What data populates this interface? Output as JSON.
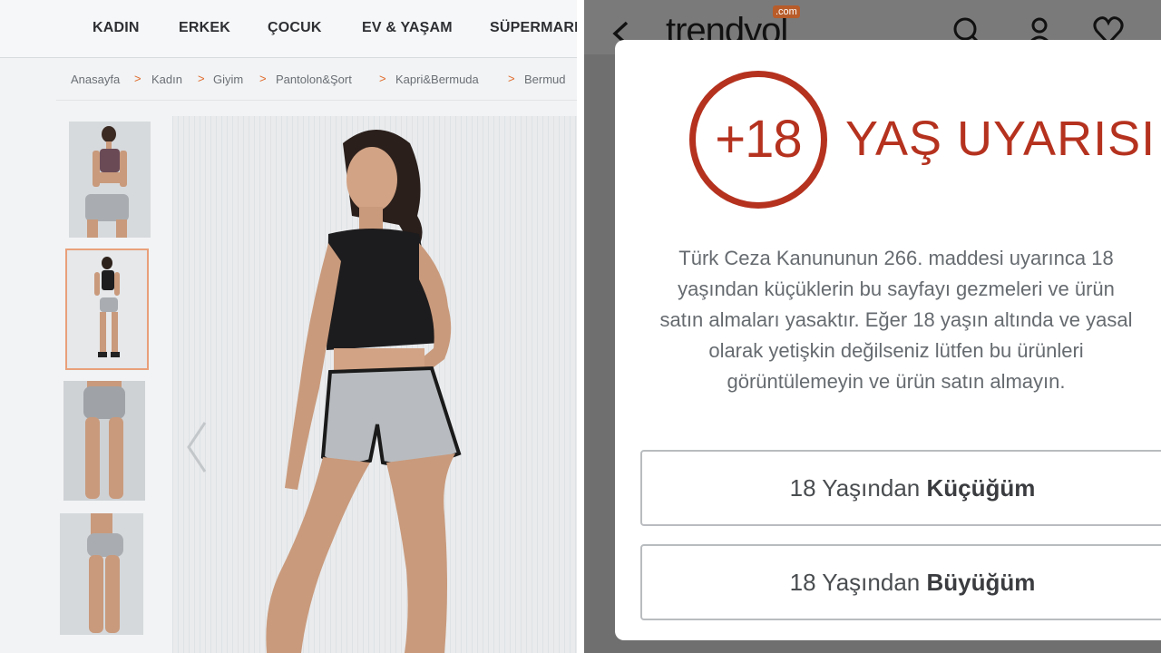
{
  "left": {
    "nav": [
      "KADIN",
      "ERKEK",
      "ÇOCUK",
      "EV & YAŞAM",
      "SÜPERMARK"
    ],
    "breadcrumb": [
      "Anasayfa",
      "Kadın",
      "Giyim",
      "Pantolon&Şort",
      "Kapri&Bermuda",
      "Bermud"
    ],
    "breadcrumb_separator": ">",
    "accent_color": "#e06a2c"
  },
  "right": {
    "logo": "trendyol",
    "logo_suffix": ".com",
    "modal": {
      "badge": "+18",
      "title": "YAŞ UYARISI",
      "body_lines": [
        "Türk Ceza Kanununun 266. maddesi uyarınca 18",
        "yaşından küçüklerin bu sayfayı gezmeleri ve ürün",
        "satın almaları yasaktır. Eğer 18 yaşın altında ve yasal",
        "olarak yetişkin değilseniz lütfen bu ürünleri",
        "görüntülemeyin ve ürün satın almayın."
      ],
      "under_button": {
        "prefix": "18 Yaşından ",
        "bold": "Küçüğüm"
      },
      "over_button": {
        "prefix": "18 Yaşından ",
        "bold": "Büyüğüm"
      },
      "accent_color": "#b5321f"
    }
  }
}
